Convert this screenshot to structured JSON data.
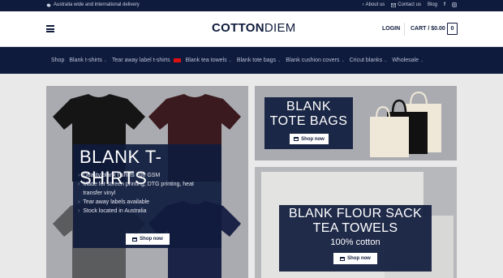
{
  "topbar": {
    "delivery_text": "Australia wide and international delivery",
    "links": [
      "About us",
      "Contact us",
      "Blog"
    ],
    "social_icons": [
      "facebook-icon",
      "instagram-icon"
    ]
  },
  "header": {
    "logo_part_a": "COTTON",
    "logo_part_b": "DIEM",
    "login_label": "LOGIN",
    "cart_label": "CART / $0.00",
    "cart_count": "0"
  },
  "nav": {
    "items": [
      {
        "label": "Shop",
        "has_chevron": false
      },
      {
        "label": "Blank t-shirts",
        "has_chevron": true
      },
      {
        "label": "Tear away label t-shirts",
        "has_chevron": false,
        "badge": true
      },
      {
        "label": "Blank tea towels",
        "has_chevron": true
      },
      {
        "label": "Blank tote bags",
        "has_chevron": true
      },
      {
        "label": "Blank cushion covers",
        "has_chevron": true
      },
      {
        "label": "Cricut blanks",
        "has_chevron": true
      },
      {
        "label": "Wholesale",
        "has_chevron": true
      }
    ]
  },
  "promo_tshirts": {
    "title": "BLANK T-SHIRTS",
    "bullets": [
      "Quality blank t-shirts 200 GSM",
      "Made for screen printing, DTG printing, heat",
      "transfer vinyl",
      "Tear away labels available",
      "Stock located in Australia"
    ],
    "button": "Shop now"
  },
  "promo_totes": {
    "line1": "BLANK",
    "line2": "TOTE BAGS",
    "button": "Shop now"
  },
  "promo_towels": {
    "line1": "BLANK FLOUR SACK",
    "line2": "TEA TOWELS",
    "subtitle": "100% cotton",
    "button": "Shop now"
  },
  "colors": {
    "navy": "#0f1b3d",
    "accent_red": "#dd1111"
  }
}
